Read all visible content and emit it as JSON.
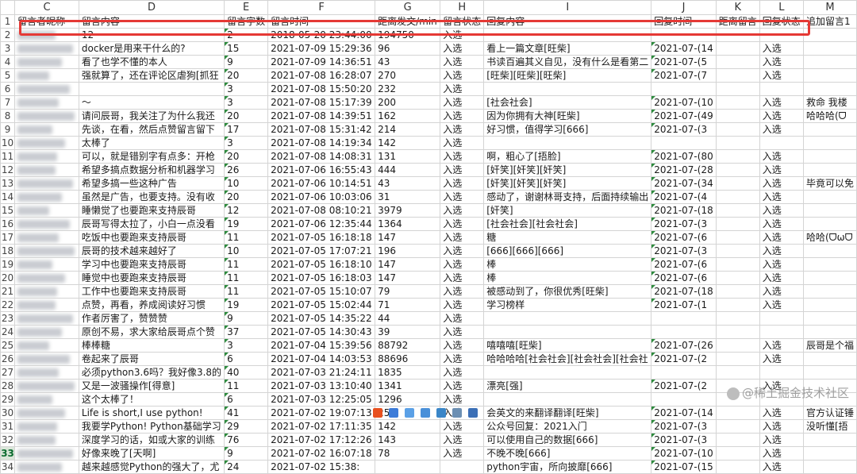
{
  "columns": [
    "C",
    "D",
    "E",
    "F",
    "G",
    "H",
    "I",
    "J",
    "K",
    "L",
    "M"
  ],
  "headers": [
    "留言者昵称",
    "留言内容",
    "留言字数",
    "留言时间",
    "距离发文/min",
    "留言状态",
    "回复内容",
    "回复时间",
    "距离留言",
    "回复状态",
    "追加留言1"
  ],
  "rows": [
    {
      "n": "2",
      "c": "",
      "d": "12",
      "e": "2",
      "f": "2018-05-20 23:44:00",
      "g": "194750",
      "h": "入选",
      "i": "",
      "j": "",
      "l": "",
      "m": ""
    },
    {
      "n": "3",
      "c": "",
      "d": "docker是用来干什么的?",
      "e": "15",
      "f": "2021-07-09 15:29:36",
      "g": "96",
      "h": "入选",
      "i": "看上一篇文章[旺柴]",
      "j": "2021-07-(14",
      "l": "入选",
      "m": ""
    },
    {
      "n": "4",
      "c": "",
      "d": "看了也学不懂的本人",
      "e": "9",
      "f": "2021-07-09 14:36:51",
      "g": "43",
      "h": "入选",
      "i": "书读百遍其义自见，没有什么是看第二",
      "j": "2021-07-(5",
      "l": "入选",
      "m": ""
    },
    {
      "n": "5",
      "c": "",
      "d": "强就算了，还在评论区虐狗[抓狂",
      "e": "20",
      "f": "2021-07-08 16:28:07",
      "g": "270",
      "h": "入选",
      "i": "[旺柴][旺柴][旺柴]",
      "j": "2021-07-(7",
      "l": "入选",
      "m": ""
    },
    {
      "n": "6",
      "c": "",
      "d": "",
      "e": "3",
      "f": "2021-07-08 15:50:20",
      "g": "232",
      "h": "入选",
      "i": "",
      "j": "",
      "l": "",
      "m": ""
    },
    {
      "n": "7",
      "c": "",
      "d": "～",
      "e": "3",
      "f": "2021-07-08 15:17:39",
      "g": "200",
      "h": "入选",
      "i": "[社会社会]",
      "j": "2021-07-(10",
      "l": "入选",
      "m": "救命 我楼"
    },
    {
      "n": "8",
      "c": "",
      "d": "请问辰哥，我关注了为什么我还",
      "e": "20",
      "f": "2021-07-08 14:39:51",
      "g": "162",
      "h": "入选",
      "i": "因为你拥有大神[旺柴]",
      "j": "2021-07-(49",
      "l": "入选",
      "m": "哈哈哈(ᗜ"
    },
    {
      "n": "9",
      "c": "",
      "d": "先谈，在看，然后点赞留言留下",
      "e": "17",
      "f": "2021-07-08 15:31:42",
      "g": "214",
      "h": "入选",
      "i": "好习惯，值得学习[666]",
      "j": "2021-07-(3",
      "l": "入选",
      "m": ""
    },
    {
      "n": "10",
      "c": "",
      "d": "太棒了",
      "e": "3",
      "f": "2021-07-08 14:19:34",
      "g": "142",
      "h": "入选",
      "i": "",
      "j": "",
      "l": "",
      "m": ""
    },
    {
      "n": "11",
      "c": "",
      "d": "可以，就是错别字有点多：开枪",
      "e": "20",
      "f": "2021-07-08 14:08:31",
      "g": "131",
      "h": "入选",
      "i": "啊，粗心了[捂脸]",
      "j": "2021-07-(80",
      "l": "入选",
      "m": ""
    },
    {
      "n": "12",
      "c": "",
      "d": "希望多搞点数据分析和机器学习",
      "e": "26",
      "f": "2021-07-06 16:55:43",
      "g": "444",
      "h": "入选",
      "i": "[奸笑][奸笑][奸笑]",
      "j": "2021-07-(28",
      "l": "入选",
      "m": ""
    },
    {
      "n": "13",
      "c": "",
      "d": "希望多搞一些这种广告",
      "e": "10",
      "f": "2021-07-06 10:14:51",
      "g": "43",
      "h": "入选",
      "i": "[奸笑][奸笑][奸笑]",
      "j": "2021-07-(34",
      "l": "入选",
      "m": "毕竟可以免"
    },
    {
      "n": "14",
      "c": "",
      "d": "虽然是广告，也要支持。没有收",
      "e": "20",
      "f": "2021-07-06 10:03:06",
      "g": "31",
      "h": "入选",
      "i": "感动了，谢谢林哥支持，后面持续输出",
      "j": "2021-07-(4",
      "l": "入选",
      "m": ""
    },
    {
      "n": "15",
      "c": "",
      "d": "睡懒觉了也要跑来支持辰哥",
      "e": "12",
      "f": "2021-07-08 08:10:21",
      "g": "3979",
      "h": "入选",
      "i": "[奸笑]",
      "j": "2021-07-(18",
      "l": "入选",
      "m": ""
    },
    {
      "n": "16",
      "c": "",
      "d": "辰哥写得太拉了，小白一点没看",
      "e": "19",
      "f": "2021-07-06 12:35:44",
      "g": "1364",
      "h": "入选",
      "i": "[社会社会][社会社会]",
      "j": "2021-07-(3",
      "l": "入选",
      "m": ""
    },
    {
      "n": "17",
      "c": "",
      "d": "吃饭中也要跑来支持辰哥",
      "e": "11",
      "f": "2021-07-05 16:18:18",
      "g": "147",
      "h": "入选",
      "i": "糖",
      "j": "2021-07-(6",
      "l": "入选",
      "m": "哈哈(ᗜωᗜ"
    },
    {
      "n": "18",
      "c": "",
      "d": "辰哥的技术越来越好了",
      "e": "10",
      "f": "2021-07-05 17:07:21",
      "g": "196",
      "h": "入选",
      "i": "[666][666][666]",
      "j": "2021-07-(3",
      "l": "入选",
      "m": ""
    },
    {
      "n": "19",
      "c": "",
      "d": "学习中也要跑来支持辰哥",
      "e": "11",
      "f": "2021-07-05 16:18:10",
      "g": "147",
      "h": "入选",
      "i": "棒",
      "j": "2021-07-(6",
      "l": "入选",
      "m": ""
    },
    {
      "n": "20",
      "c": "",
      "d": "睡觉中也要跑来支持辰哥",
      "e": "11",
      "f": "2021-07-05 16:18:03",
      "g": "147",
      "h": "入选",
      "i": "棒",
      "j": "2021-07-(6",
      "l": "入选",
      "m": ""
    },
    {
      "n": "21",
      "c": "",
      "d": "工作中也要跑来支持辰哥",
      "e": "11",
      "f": "2021-07-05 15:10:07",
      "g": "79",
      "h": "入选",
      "i": "被感动到了，你很优秀[旺柴]",
      "j": "2021-07-(18",
      "l": "入选",
      "m": ""
    },
    {
      "n": "22",
      "c": "",
      "d": "点赞，再看，养成阅读好习惯",
      "e": "19",
      "f": "2021-07-05 15:02:44",
      "g": "71",
      "h": "入选",
      "i": "学习榜样",
      "j": "2021-07-(1",
      "l": "入选",
      "m": ""
    },
    {
      "n": "23",
      "c": "",
      "d": "作者厉害了，赞赞赞",
      "e": "9",
      "f": "2021-07-05 14:35:22",
      "g": "44",
      "h": "入选",
      "i": "",
      "j": "",
      "l": "",
      "m": ""
    },
    {
      "n": "24",
      "c": "",
      "d": "原创不易，求大家给辰哥点个赞",
      "e": "37",
      "f": "2021-07-05 14:30:43",
      "g": "39",
      "h": "入选",
      "i": "",
      "j": "",
      "l": "",
      "m": ""
    },
    {
      "n": "25",
      "c": "",
      "d": "棒棒糖",
      "e": "3",
      "f": "2021-07-04 15:39:56",
      "g": "88792",
      "h": "入选",
      "i": "嘻嘻嘻[旺柴]",
      "j": "2021-07-(26",
      "l": "入选",
      "m": "辰哥是个福"
    },
    {
      "n": "26",
      "c": "",
      "d": "卷起来了辰哥",
      "e": "6",
      "f": "2021-07-04 14:03:53",
      "g": "88696",
      "h": "入选",
      "i": "哈哈哈哈[社会社会][社会社会][社会社",
      "j": "2021-07-(2",
      "l": "入选",
      "m": ""
    },
    {
      "n": "27",
      "c": "",
      "d": "必须python3.6吗？我好像3.8的",
      "e": "40",
      "f": "2021-07-03 21:24:11",
      "g": "1835",
      "h": "入选",
      "i": "",
      "j": "",
      "l": "",
      "m": ""
    },
    {
      "n": "28",
      "c": "",
      "d": "又是一波骚操作[得意]",
      "e": "11",
      "f": "2021-07-03 13:10:40",
      "g": "1341",
      "h": "入选",
      "i": "漂亮[强]",
      "j": "2021-07-(2",
      "l": "入选",
      "m": ""
    },
    {
      "n": "29",
      "c": "",
      "d": "这个太棒了！",
      "e": "6",
      "f": "2021-07-03 12:25:05",
      "g": "1296",
      "h": "入选",
      "i": "",
      "j": "",
      "l": "",
      "m": ""
    },
    {
      "n": "30",
      "c": "",
      "d": "Life is short,I use python!",
      "e": "41",
      "f": "2021-07-02 19:07:13",
      "g": "258",
      "h": "入选",
      "i": "会英文的来翻译翻译[旺柴]",
      "j": "2021-07-(14",
      "l": "入选",
      "m": "官方认证锤"
    },
    {
      "n": "31",
      "c": "",
      "d": "我要学Python! Python基础学习",
      "e": "29",
      "f": "2021-07-02 17:11:35",
      "g": "142",
      "h": "入选",
      "i": "公众号回复：2021入门",
      "j": "2021-07-(3",
      "l": "入选",
      "m": "没听懂[捂"
    },
    {
      "n": "32",
      "c": "",
      "d": "深度学习的话，如或大家的训练",
      "e": "76",
      "f": "2021-07-02 17:12:26",
      "g": "143",
      "h": "入选",
      "i": "可以使用自己的数据[666]",
      "j": "2021-07-(3",
      "l": "入选",
      "m": ""
    },
    {
      "n": "33",
      "c": "",
      "d": "好像来晚了[天啊]",
      "e": "9",
      "f": "2021-07-02 16:07:18",
      "g": "78",
      "h": "入选",
      "i": "不晚不晚[666]",
      "j": "2021-07-(10",
      "l": "入选",
      "m": ""
    },
    {
      "n": "34",
      "c": "",
      "d": "越来越感觉Python的强大了，尤",
      "e": "24",
      "f": "2021-07-02 15:38:",
      "g": "",
      "h": "",
      "i": "python宇宙，所向披靡[666]",
      "j": "2021-07-(15",
      "l": "入选",
      "m": ""
    }
  ],
  "watermark": "@稀土掘金技术社区",
  "selected_row": "33"
}
